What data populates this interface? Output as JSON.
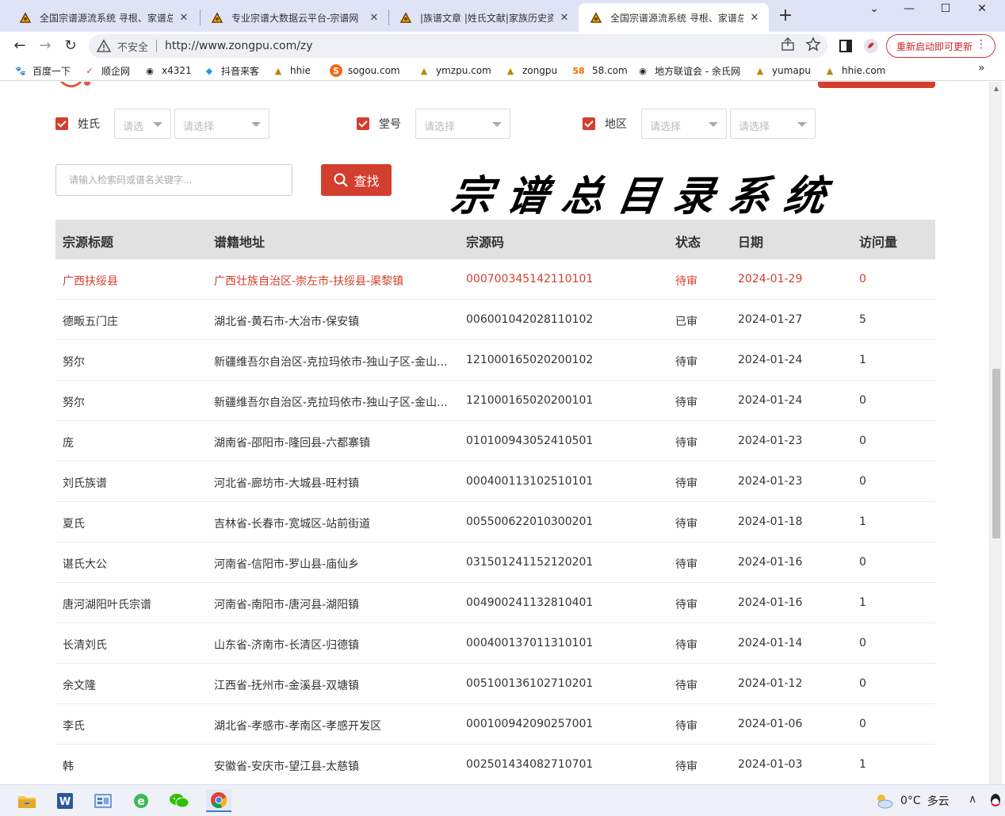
{
  "browser": {
    "tabs": [
      {
        "title": "全国宗谱源流系统 寻根、家谱总目",
        "active": false
      },
      {
        "title": "专业宗谱大数据云平台-宗谱网",
        "active": false
      },
      {
        "title": "|族谱文章 |姓氏文献|家族历史资料",
        "active": false
      },
      {
        "title": "全国宗谱源流系统 寻根、家谱总目",
        "active": true
      }
    ],
    "security_label": "不安全",
    "url": "http://www.zongpu.com/zy",
    "update_button": "重新启动即可更新",
    "bookmarks": [
      {
        "label": "百度一下",
        "icon": "baidu-icon"
      },
      {
        "label": "顺企网",
        "icon": "shunqi-icon"
      },
      {
        "label": "x4321",
        "icon": "globe-icon"
      },
      {
        "label": "抖音来客",
        "icon": "douyin-icon"
      },
      {
        "label": "hhie",
        "icon": "zongpu-icon"
      },
      {
        "label": "sogou.com",
        "icon": "sogou-icon"
      },
      {
        "label": "ymzpu.com",
        "icon": "zongpu-icon"
      },
      {
        "label": "zongpu",
        "icon": "zongpu-icon"
      },
      {
        "label": "58.com",
        "icon": "58-icon"
      },
      {
        "label": "地方联谊会 - 余氏网",
        "icon": "globe-icon"
      },
      {
        "label": "yumapu",
        "icon": "zongpu-icon"
      },
      {
        "label": "hhie.com",
        "icon": "zongpu-icon"
      }
    ]
  },
  "filters": {
    "surname_label": "姓氏",
    "hall_label": "堂号",
    "region_label": "地区",
    "surname_select_1": "请选",
    "surname_select_2": "请选择",
    "hall_select": "请选择",
    "region_select_1": "请选择",
    "region_select_2": "请选择"
  },
  "search": {
    "placeholder": "请输入检索码或谱名关键字...",
    "button_label": "查找"
  },
  "page_title": "宗谱总目录系统",
  "table": {
    "headers": [
      "宗源标题",
      "谱籍地址",
      "宗源码",
      "状态",
      "日期",
      "访问量"
    ],
    "rows": [
      {
        "title": "广西扶绥县",
        "address": "广西壮族自治区-崇左市-扶绥县-渠黎镇",
        "code": "000700345142110101",
        "status": "待审",
        "date": "2024-01-29",
        "visits": "0",
        "highlight": true
      },
      {
        "title": "德畈五门庄",
        "address": "湖北省-黄石市-大冶市-保安镇",
        "code": "006001042028110102",
        "status": "已审",
        "date": "2024-01-27",
        "visits": "5"
      },
      {
        "title": "努尔",
        "address": "新疆维吾尔自治区-克拉玛依市-独山子区-金山...",
        "code": "121000165020200102",
        "status": "待审",
        "date": "2024-01-24",
        "visits": "1"
      },
      {
        "title": "努尔",
        "address": "新疆维吾尔自治区-克拉玛依市-独山子区-金山...",
        "code": "121000165020200101",
        "status": "待审",
        "date": "2024-01-24",
        "visits": "0"
      },
      {
        "title": "庞",
        "address": "湖南省-邵阳市-隆回县-六都寨镇",
        "code": "010100943052410501",
        "status": "待审",
        "date": "2024-01-23",
        "visits": "0"
      },
      {
        "title": "刘氏族谱",
        "address": "河北省-廊坊市-大城县-旺村镇",
        "code": "000400113102510101",
        "status": "待审",
        "date": "2024-01-23",
        "visits": "0"
      },
      {
        "title": "夏氏",
        "address": "吉林省-长春市-宽城区-站前街道",
        "code": "005500622010300201",
        "status": "待审",
        "date": "2024-01-18",
        "visits": "1"
      },
      {
        "title": "谌氏大公",
        "address": "河南省-信阳市-罗山县-庙仙乡",
        "code": "031501241152120201",
        "status": "待审",
        "date": "2024-01-16",
        "visits": "0"
      },
      {
        "title": "唐河湖阳叶氏宗谱",
        "address": "河南省-南阳市-唐河县-湖阳镇",
        "code": "004900241132810401",
        "status": "待审",
        "date": "2024-01-16",
        "visits": "1"
      },
      {
        "title": "长清刘氏",
        "address": "山东省-济南市-长清区-归德镇",
        "code": "000400137011310101",
        "status": "待审",
        "date": "2024-01-14",
        "visits": "0"
      },
      {
        "title": "余文隆",
        "address": "江西省-抚州市-金溪县-双塘镇",
        "code": "005100136102710201",
        "status": "待审",
        "date": "2024-01-12",
        "visits": "0"
      },
      {
        "title": "李氏",
        "address": "湖北省-孝感市-孝南区-孝感开发区",
        "code": "000100942090257001",
        "status": "待审",
        "date": "2024-01-06",
        "visits": "0"
      },
      {
        "title": "韩",
        "address": "安徽省-安庆市-望江县-太慈镇",
        "code": "002501434082710701",
        "status": "待审",
        "date": "2024-01-03",
        "visits": "1"
      }
    ]
  },
  "taskbar": {
    "weather_temp": "0°C",
    "weather_desc": "多云"
  },
  "colors": {
    "accent": "#d23f2e",
    "header_bg": "#e1e1e1",
    "tabstrip": "#dfe3f6"
  }
}
